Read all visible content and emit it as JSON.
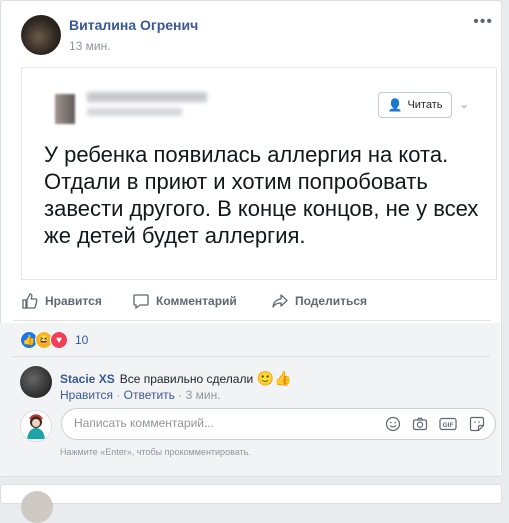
{
  "post": {
    "author": "Виталина Огренич",
    "time": "13 мин.",
    "more_icon": "•••",
    "shared_image": {
      "follow_label": "Читать",
      "text": "У ребенка появилась аллергия на кота. Отдали в приют и хотим попробовать завести другого. В конце концов, не у всех же детей будет аллергия."
    }
  },
  "actions": {
    "like": "Нравится",
    "comment": "Комментарий",
    "share": "Поделиться"
  },
  "reactions": {
    "count": "10"
  },
  "comment": {
    "author": "Stacie XS",
    "text": "Все правильно сделали",
    "emoji": "🙂👍",
    "like_link": "Нравится",
    "reply_link": "Ответить",
    "time": "3 мин.",
    "dot": "·"
  },
  "composer": {
    "placeholder": "Написать комментарий...",
    "gif_label": "GIF",
    "hint": "Нажмите «Enter», чтобы прокомментировать."
  },
  "colors": {
    "link": "#385898",
    "muted": "#90949c",
    "like": "#1877f2",
    "haha": "#f7b125",
    "love": "#f33e58"
  }
}
